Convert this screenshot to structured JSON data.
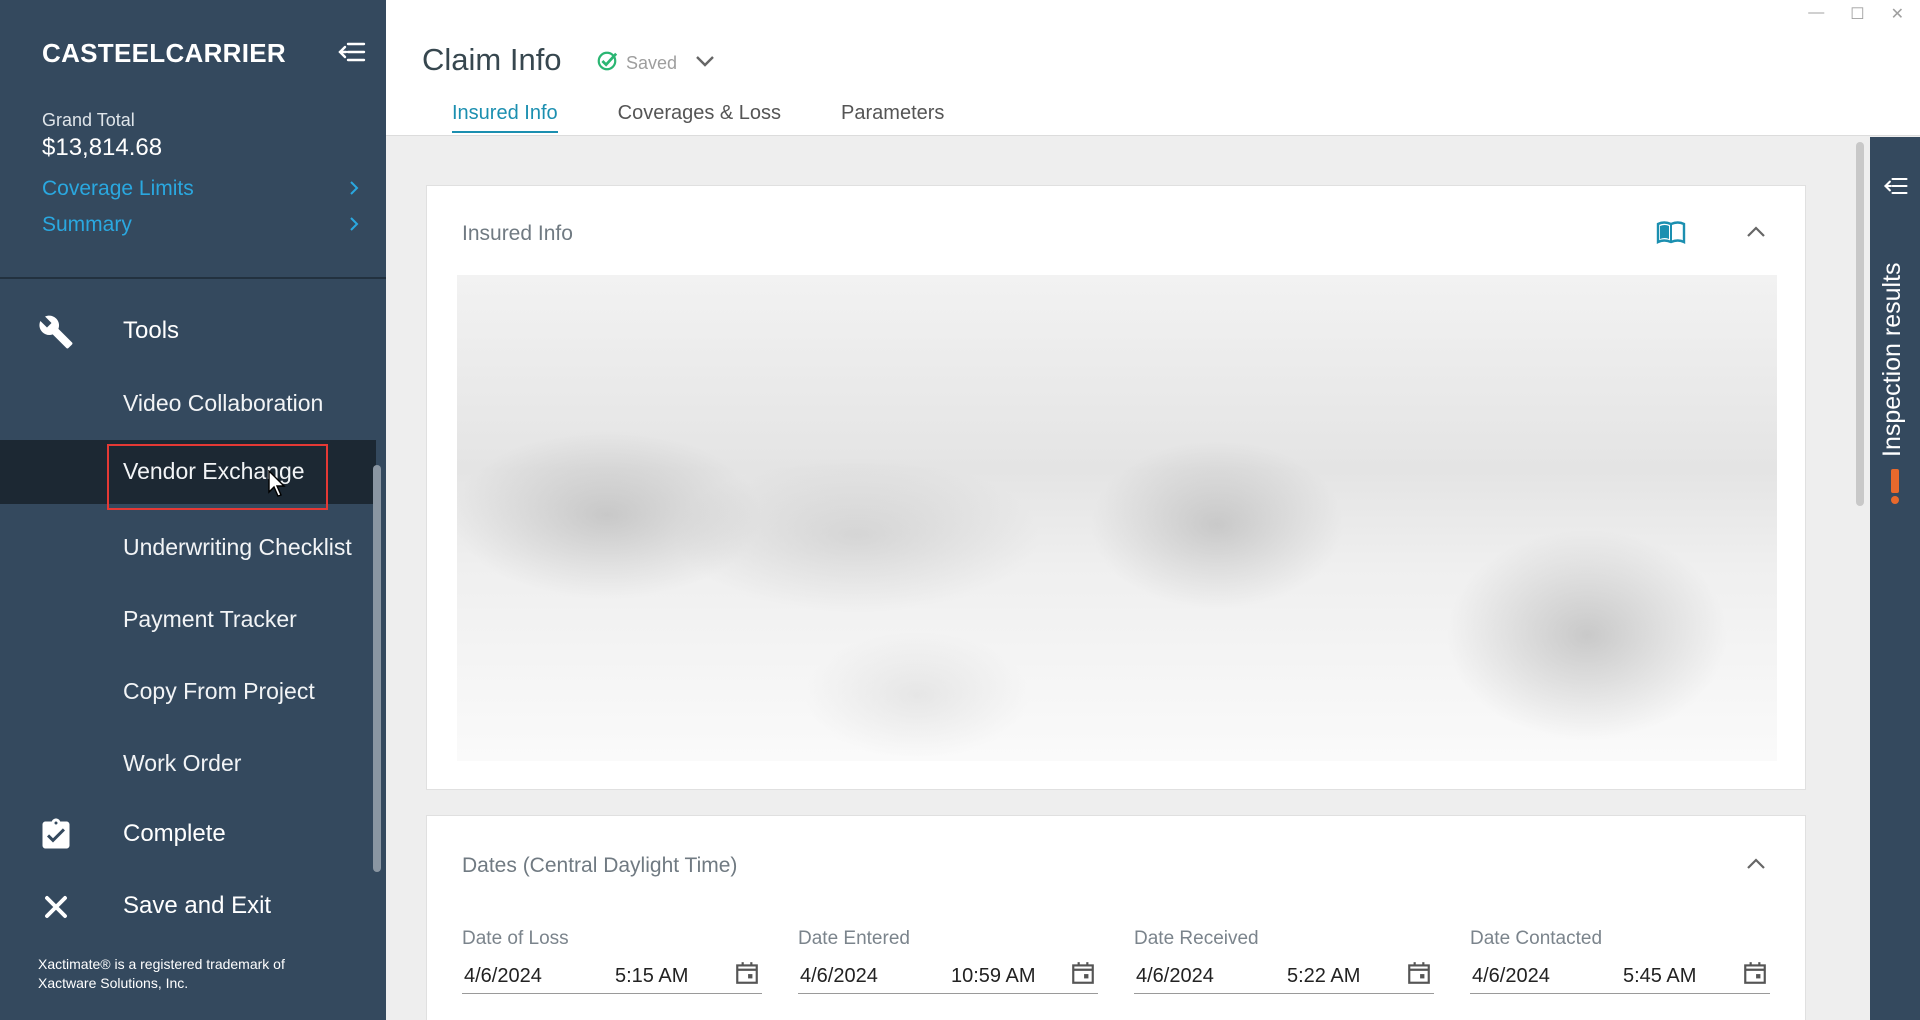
{
  "sidebar": {
    "brand": "CASTEELCARRIER",
    "grand_total_label": "Grand Total",
    "grand_total_value": "$13,814.68",
    "links": [
      {
        "label": "Coverage Limits"
      },
      {
        "label": "Summary"
      }
    ],
    "tools_label": "Tools",
    "tools_items": [
      {
        "label": "Video Collaboration"
      },
      {
        "label": "Vendor Exchange"
      },
      {
        "label": "Underwriting Checklist"
      },
      {
        "label": "Payment Tracker"
      },
      {
        "label": "Copy From Project"
      },
      {
        "label": "Work Order"
      }
    ],
    "complete_label": "Complete",
    "save_exit_label": "Save and Exit",
    "trademark_line1": "Xactimate® is a registered trademark of",
    "trademark_line2": "Xactware Solutions, Inc."
  },
  "header": {
    "title": "Claim Info",
    "status": "Saved",
    "tabs": [
      {
        "label": "Insured Info",
        "active": true
      },
      {
        "label": "Coverages & Loss",
        "active": false
      },
      {
        "label": "Parameters",
        "active": false
      }
    ]
  },
  "insured_card": {
    "title": "Insured Info"
  },
  "dates_card": {
    "title": "Dates (Central Daylight Time)",
    "fields": [
      {
        "label": "Date of Loss",
        "date": "4/6/2024",
        "time": "5:15 AM"
      },
      {
        "label": "Date Entered",
        "date": "4/6/2024",
        "time": "10:59 AM"
      },
      {
        "label": "Date Received",
        "date": "4/6/2024",
        "time": "5:22 AM"
      },
      {
        "label": "Date Contacted",
        "date": "4/6/2024",
        "time": "5:45 AM"
      }
    ]
  },
  "right_panel": {
    "label": "Inspection results"
  },
  "colors": {
    "sidebar_bg": "#34495e",
    "accent": "#1b8fb0",
    "link": "#2aa8e0",
    "highlight": "#e53935",
    "warning": "#e8692c",
    "saved_check": "#2bb673"
  },
  "icons": [
    "sidebar-collapse-icon",
    "chevron-right-icon",
    "wrench-icon",
    "clipboard-check-icon",
    "close-icon",
    "check-circle-icon",
    "chevron-down-icon",
    "book-icon",
    "chevron-up-icon",
    "calendar-icon",
    "panel-expand-icon",
    "exclamation-icon",
    "mouse-cursor-icon"
  ]
}
